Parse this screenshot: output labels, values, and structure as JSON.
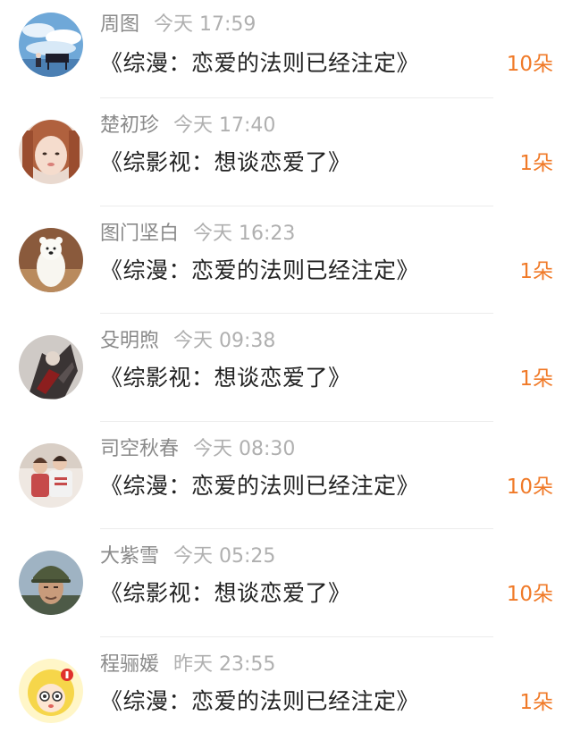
{
  "accent_color": "#f07a28",
  "items": [
    {
      "name": "周图",
      "time": "今天 17:59",
      "book": "《综漫：恋爱的法则已经注定》",
      "amount": "10朵",
      "avatar_icon": "anime-piano-sky-avatar"
    },
    {
      "name": "楚初珍",
      "time": "今天 17:40",
      "book": "《综影视：想谈恋爱了》",
      "amount": "1朵",
      "avatar_icon": "girl-portrait-avatar"
    },
    {
      "name": "图门坚白",
      "time": "今天 16:23",
      "book": "《综漫：恋爱的法则已经注定》",
      "amount": "1朵",
      "avatar_icon": "white-bear-avatar"
    },
    {
      "name": "殳明煦",
      "time": "今天 09:38",
      "book": "《综影视：想谈恋爱了》",
      "amount": "1朵",
      "avatar_icon": "dark-art-avatar"
    },
    {
      "name": "司空秋春",
      "time": "今天 08:30",
      "book": "《综漫：恋爱的法则已经注定》",
      "amount": "10朵",
      "avatar_icon": "couple-photo-avatar"
    },
    {
      "name": "大紫雪",
      "time": "今天 05:25",
      "book": "《综影视：想谈恋爱了》",
      "amount": "10朵",
      "avatar_icon": "soldier-helmet-avatar"
    },
    {
      "name": "程骊媛",
      "time": "昨天 23:55",
      "book": "《综漫：恋爱的法则已经注定》",
      "amount": "1朵",
      "avatar_icon": "cartoon-blonde-avatar"
    }
  ]
}
